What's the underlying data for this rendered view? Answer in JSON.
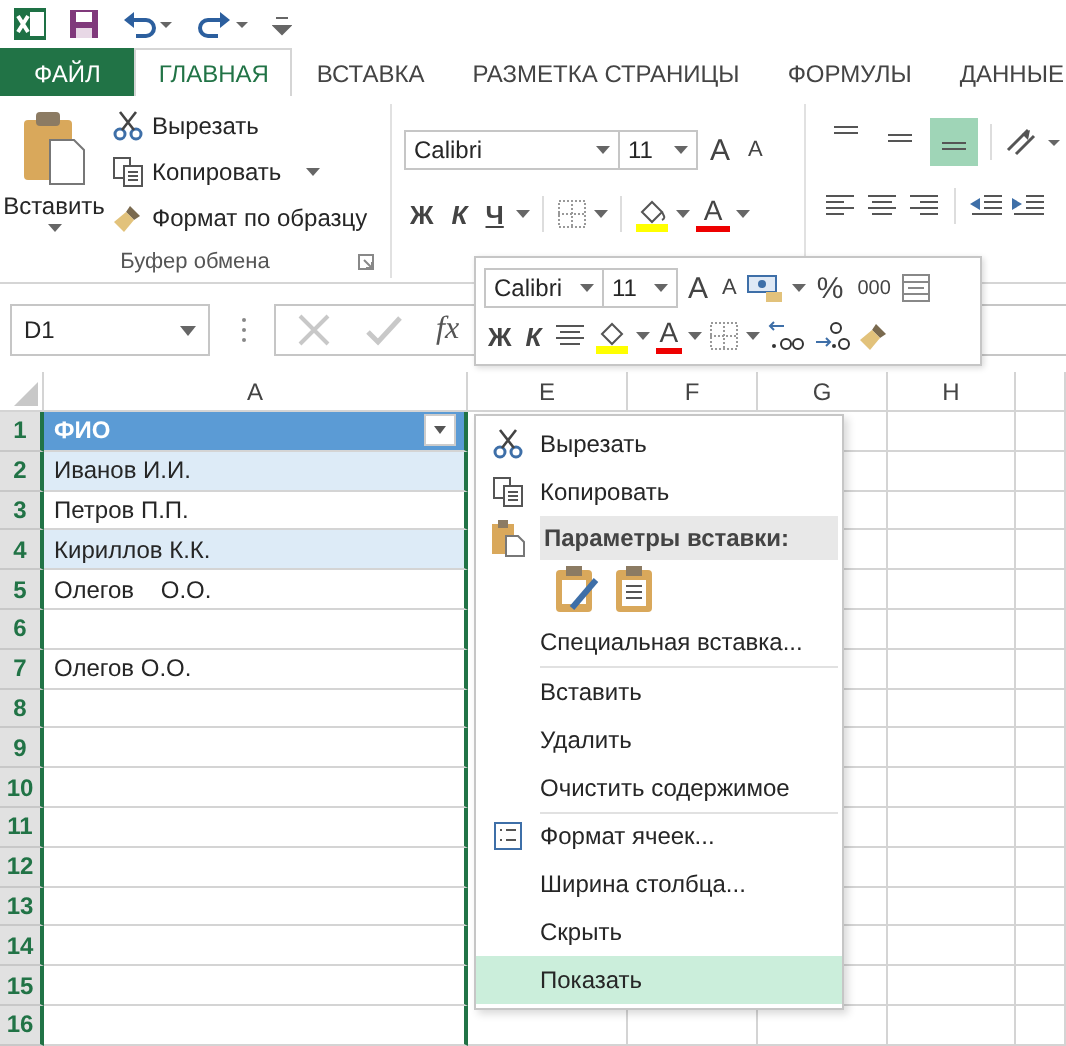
{
  "tabs": [
    {
      "label": "ФАЙЛ",
      "kind": "file",
      "selected": false
    },
    {
      "label": "ГЛАВНАЯ",
      "kind": "tab",
      "selected": true
    },
    {
      "label": "ВСТАВКА",
      "kind": "tab",
      "selected": false
    },
    {
      "label": "РАЗМЕТКА СТРАНИЦЫ",
      "kind": "tab",
      "selected": false
    },
    {
      "label": "ФОРМУЛЫ",
      "kind": "tab",
      "selected": false
    },
    {
      "label": "ДАННЫЕ",
      "kind": "tab",
      "selected": false
    }
  ],
  "clipboard": {
    "paste": "Вставить",
    "cut": "Вырезать",
    "copy": "Копировать",
    "format_painter": "Формат по образцу",
    "group_label": "Буфер обмена"
  },
  "font": {
    "name": "Calibri",
    "size": "11",
    "grow": "A",
    "shrink": "A",
    "bold": "Ж",
    "italic": "К",
    "underline": "Ч",
    "font_color": "A"
  },
  "alignment": {
    "vertical": [
      {
        "selected": false
      },
      {
        "selected": false
      },
      {
        "selected": true
      }
    ]
  },
  "formula_bar": {
    "name_box": "D1",
    "fx": "fx"
  },
  "sheet": {
    "columns": [
      "A",
      "E",
      "F",
      "G",
      "H"
    ],
    "rows": [
      {
        "number": "1",
        "cell": "ФИО",
        "kind": "header"
      },
      {
        "number": "2",
        "cell": "Иванов И.И.",
        "kind": "band"
      },
      {
        "number": "3",
        "cell": "Петров П.П.",
        "kind": "plain"
      },
      {
        "number": "4",
        "cell": "Кириллов К.К.",
        "kind": "band"
      },
      {
        "number": "5",
        "cell": "Олегов    О.О.",
        "kind": "plain"
      },
      {
        "number": "6",
        "kind": "plain"
      },
      {
        "number": "7",
        "cell": "Олегов О.О.",
        "kind": "plain"
      },
      {
        "number": "8",
        "kind": "plain"
      },
      {
        "number": "9",
        "kind": "plain"
      },
      {
        "number": "10",
        "kind": "plain"
      },
      {
        "number": "11",
        "kind": "plain"
      },
      {
        "number": "12",
        "kind": "plain"
      },
      {
        "number": "13",
        "kind": "plain"
      },
      {
        "number": "14",
        "kind": "plain"
      },
      {
        "number": "15",
        "kind": "plain"
      },
      {
        "number": "16",
        "kind": "plain"
      }
    ]
  },
  "mini_toolbar": {
    "font": "Calibri",
    "size": "11",
    "grow": "A",
    "shrink": "A",
    "percent": "%",
    "thousands": "000",
    "bold": "Ж",
    "italic": "К",
    "font_color": "A"
  },
  "context_menu": [
    {
      "label": "Вырезать",
      "kind": "cut",
      "selected": false
    },
    {
      "label": "Копировать",
      "kind": "copy",
      "selected": false
    },
    {
      "label": "Параметры вставки:",
      "kind": "heading"
    },
    {
      "kind": "paste_options"
    },
    {
      "label": "Специальная вставка...",
      "kind": "plain",
      "selected": false
    },
    {
      "kind": "divider"
    },
    {
      "label": "Вставить",
      "kind": "plain",
      "selected": false
    },
    {
      "label": "Удалить",
      "kind": "plain",
      "selected": false
    },
    {
      "label": "Очистить содержимое",
      "kind": "plain",
      "selected": false
    },
    {
      "kind": "divider"
    },
    {
      "label": "Формат ячеек...",
      "kind": "format",
      "selected": false
    },
    {
      "label": "Ширина столбца...",
      "kind": "plain",
      "selected": false
    },
    {
      "label": "Скрыть",
      "kind": "plain",
      "selected": false
    },
    {
      "label": "Показать",
      "kind": "plain",
      "selected": true
    }
  ]
}
